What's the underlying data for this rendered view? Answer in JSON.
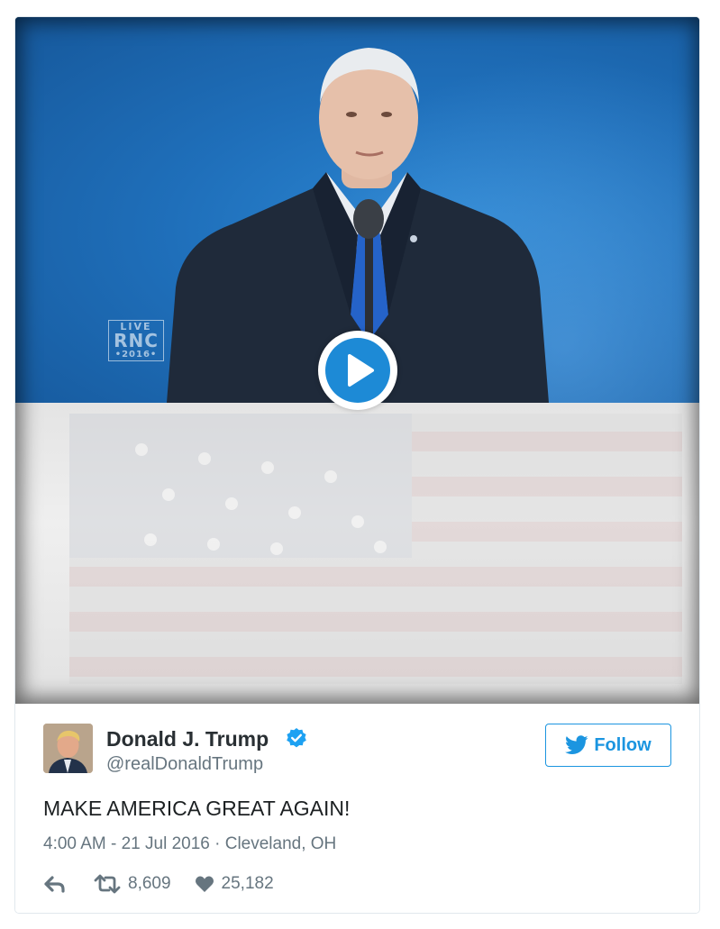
{
  "video": {
    "watermark": {
      "live": "LIVE",
      "brand": "RNC",
      "year": "•2016•"
    }
  },
  "tweet": {
    "author_name": "Donald J. Trump",
    "author_handle": "@realDonaldTrump",
    "verified": true,
    "follow_label": "Follow",
    "text": "MAKE AMERICA GREAT AGAIN!",
    "dateline": "4:00 AM - 21 Jul 2016 · Cleveland, OH",
    "retweet_count": "8,609",
    "like_count": "25,182"
  },
  "colors": {
    "accent": "#1b95e0",
    "stage_blue": "#1f6fba",
    "text": "#1c2022",
    "muted": "#66757f"
  },
  "icons": [
    "play-icon",
    "verified-badge-icon",
    "twitter-bird-icon",
    "reply-icon",
    "retweet-icon",
    "heart-icon"
  ]
}
